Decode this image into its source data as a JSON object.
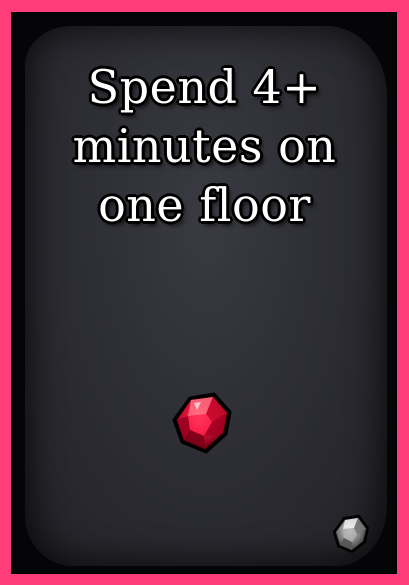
{
  "card": {
    "title_lines": [
      "Spend 4+",
      "minutes on",
      "one floor"
    ],
    "frame_color": "#ff3d7a",
    "panel_color": "#2e2e35"
  },
  "icons": {
    "main_gem": "red-gem-icon",
    "corner_gem": "gray-gem-icon"
  }
}
